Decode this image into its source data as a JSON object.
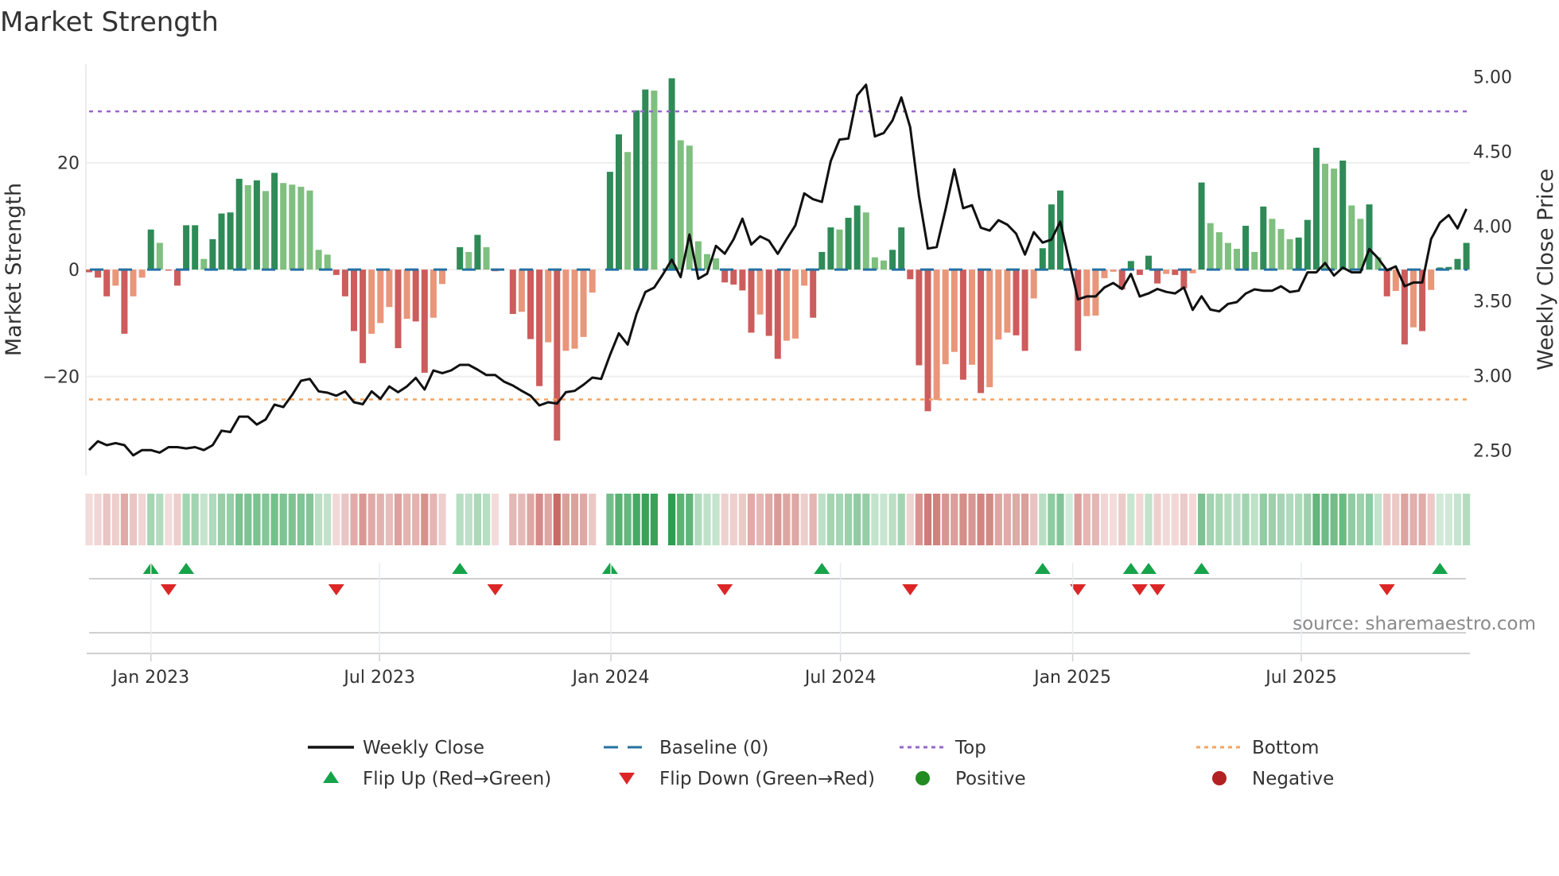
{
  "title": "Market Strength",
  "source": "source: sharemaestro.com",
  "colors": {
    "strong_positive": "#2e8b57",
    "weak_positive": "#7fbf7f",
    "strong_negative": "#cd5c5c",
    "weak_negative": "#e9967a",
    "price_line": "#111111",
    "baseline": "#2471a3",
    "top": "#9966cc",
    "bottom": "#f4a460",
    "flip_up": "#16a34a",
    "flip_down": "#dc2626",
    "positive_dot": "#228b22",
    "negative_dot": "#b22222",
    "heat_pos": "#2f9e50",
    "heat_neg": "#c4605a"
  },
  "chart_data": {
    "type": "bar",
    "title": "Market Strength",
    "ylabel": "Market Strength",
    "y2label": "Weekly Close Price",
    "ylim": [
      -38.5,
      38.4
    ],
    "y2lim": [
      2.333,
      5.082
    ],
    "yticks": [
      {
        "value": 20,
        "label": "20"
      },
      {
        "value": 0,
        "label": "0"
      },
      {
        "value": -20,
        "label": "−20"
      }
    ],
    "y2ticks": [
      {
        "value": 5.0,
        "label": "5.00"
      },
      {
        "value": 4.5,
        "label": "4.50"
      },
      {
        "value": 4.0,
        "label": "4.00"
      },
      {
        "value": 3.5,
        "label": "3.50"
      },
      {
        "value": 3.0,
        "label": "3.00"
      },
      {
        "value": 2.5,
        "label": "2.50"
      }
    ],
    "xticks": [
      {
        "week": 7.0,
        "label": "Jan 2023"
      },
      {
        "week": 32.9,
        "label": "Jul 2023"
      },
      {
        "week": 59.1,
        "label": "Jan 2024"
      },
      {
        "week": 85.1,
        "label": "Jul 2024"
      },
      {
        "week": 111.4,
        "label": "Jan 2025"
      },
      {
        "week": 137.3,
        "label": "Jul 2025"
      }
    ],
    "grid": true,
    "top_level": 29.6,
    "bottom_level": -24.3,
    "baseline": 0,
    "strength": [
      -0.5,
      -1.5,
      -5,
      -3,
      -12,
      -5,
      -1.5,
      7.5,
      5,
      -0.2,
      -3,
      8.3,
      8.3,
      2,
      5.7,
      10.5,
      10.7,
      17,
      15.8,
      16.7,
      14.7,
      18.1,
      16.2,
      15.9,
      15.5,
      14.8,
      3.7,
      2.8,
      -1,
      -5,
      -11.5,
      -17.5,
      -12,
      -10,
      -7,
      -14.7,
      -9.2,
      -9.7,
      -19.3,
      -9,
      -2.7,
      0,
      4.2,
      3.3,
      6.5,
      4.2,
      -0.3,
      0,
      -8.3,
      -7.9,
      -13,
      -21.8,
      -13.6,
      -32,
      -15.2,
      -14.8,
      -12.6,
      -4.3,
      0,
      18.3,
      25.3,
      22,
      29.8,
      33.7,
      33.5,
      0,
      35.8,
      24.2,
      23.2,
      5.3,
      2.9,
      2.1,
      -2.4,
      -2.8,
      -3.9,
      -11.8,
      -8.4,
      -12.4,
      -16.7,
      -13.3,
      -12.9,
      -3,
      -9,
      3.3,
      7.9,
      7.5,
      9.7,
      12,
      10.7,
      2.3,
      1.7,
      3.7,
      7.9,
      -1.8,
      -17.9,
      -26.5,
      -24.4,
      -17.7,
      -15.4,
      -20.6,
      -17.8,
      -23.1,
      -22,
      -13.1,
      -11.8,
      -12.3,
      -15.2,
      -5.4,
      4,
      12.2,
      14.8,
      0.3,
      -15.2,
      -8.7,
      -8.6,
      -1.6,
      -0.4,
      -3.7,
      1.6,
      -1,
      2.6,
      -2.6,
      -0.8,
      -1,
      -3.5,
      -0.7,
      16.3,
      8.7,
      7,
      5,
      3.9,
      8.2,
      3.3,
      11.8,
      9.5,
      7.6,
      5.7,
      6,
      9.3,
      22.8,
      19.8,
      18.9,
      20.4,
      12,
      9.5,
      12.2,
      2.3,
      -5,
      -4,
      -14,
      -10.8,
      -11.5,
      -3.8,
      0.4,
      0.5,
      2,
      5
    ],
    "weekly_close": [
      2.502,
      2.561,
      2.535,
      2.549,
      2.535,
      2.467,
      2.502,
      2.502,
      2.485,
      2.522,
      2.522,
      2.513,
      2.522,
      2.502,
      2.535,
      2.632,
      2.623,
      2.726,
      2.726,
      2.673,
      2.707,
      2.806,
      2.79,
      2.871,
      2.966,
      2.978,
      2.895,
      2.886,
      2.866,
      2.895,
      2.822,
      2.809,
      2.895,
      2.845,
      2.928,
      2.889,
      2.928,
      2.985,
      2.907,
      3.035,
      3.017,
      3.035,
      3.072,
      3.072,
      3.04,
      3.004,
      3.004,
      2.96,
      2.934,
      2.898,
      2.866,
      2.801,
      2.822,
      2.813,
      2.889,
      2.898,
      2.939,
      2.987,
      2.978,
      3.138,
      3.283,
      3.208,
      3.412,
      3.559,
      3.589,
      3.678,
      3.776,
      3.659,
      3.944,
      3.648,
      3.682,
      3.868,
      3.816,
      3.912,
      4.05,
      3.877,
      3.932,
      3.903,
      3.815,
      3.912,
      4.006,
      4.219,
      4.18,
      4.162,
      4.435,
      4.579,
      4.586,
      4.875,
      4.946,
      4.6,
      4.623,
      4.707,
      4.861,
      4.662,
      4.2,
      3.85,
      3.86,
      4.11,
      4.38,
      4.12,
      4.14,
      3.99,
      3.97,
      4.04,
      4.01,
      3.95,
      3.81,
      3.96,
      3.89,
      3.91,
      4.03,
      3.77,
      3.51,
      3.53,
      3.53,
      3.59,
      3.62,
      3.58,
      3.68,
      3.53,
      3.55,
      3.58,
      3.56,
      3.55,
      3.59,
      3.44,
      3.531,
      3.442,
      3.43,
      3.48,
      3.492,
      3.549,
      3.577,
      3.568,
      3.568,
      3.598,
      3.559,
      3.568,
      3.691,
      3.691,
      3.754,
      3.669,
      3.723,
      3.691,
      3.691,
      3.847,
      3.785,
      3.705,
      3.731,
      3.598,
      3.623,
      3.623,
      3.914,
      4.024,
      4.074,
      3.985,
      4.116
    ],
    "legend": [
      {
        "key": "weekly_close",
        "label": "Weekly Close",
        "symbol": "line"
      },
      {
        "key": "baseline",
        "label": "Baseline (0)",
        "symbol": "dash"
      },
      {
        "key": "top",
        "label": "Top",
        "symbol": "dot"
      },
      {
        "key": "bottom",
        "label": "Bottom",
        "symbol": "dot"
      },
      {
        "key": "flip_up",
        "label": "Flip Up (Red→Green)",
        "symbol": "triangle-up"
      },
      {
        "key": "flip_down",
        "label": "Flip Down (Green→Red)",
        "symbol": "triangle-down"
      },
      {
        "key": "positive_dot",
        "label": "Positive",
        "symbol": "circle"
      },
      {
        "key": "negative_dot",
        "label": "Negative",
        "symbol": "circle"
      }
    ],
    "legend_position": "bottom"
  }
}
